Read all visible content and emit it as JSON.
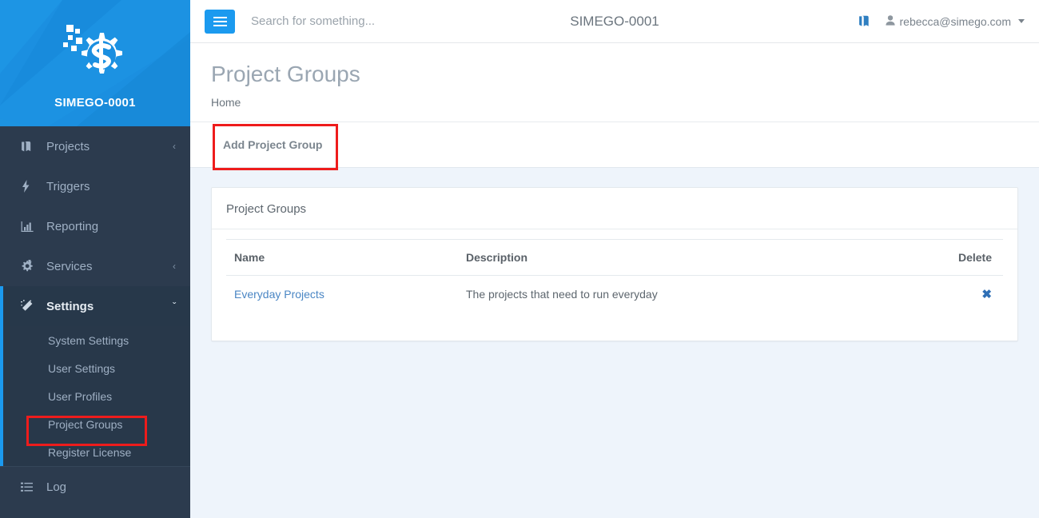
{
  "brand": {
    "title": "SIMEGO-0001",
    "logo_icon": "gear-s-logo"
  },
  "sidebar": {
    "items": [
      {
        "label": "Projects",
        "icon": "book-icon",
        "chevron": "‹",
        "active": false
      },
      {
        "label": "Triggers",
        "icon": "bolt-icon",
        "chevron": "",
        "active": false
      },
      {
        "label": "Reporting",
        "icon": "bar-chart-icon",
        "chevron": "",
        "active": false
      },
      {
        "label": "Services",
        "icon": "gears-icon",
        "chevron": "‹",
        "active": false
      },
      {
        "label": "Settings",
        "icon": "magic-wand-icon",
        "chevron": "ˇ",
        "active": true
      }
    ],
    "submenu": [
      {
        "label": "System Settings",
        "highlighted": false
      },
      {
        "label": "User Settings",
        "highlighted": false
      },
      {
        "label": "User Profiles",
        "highlighted": false
      },
      {
        "label": "Project Groups",
        "highlighted": true
      },
      {
        "label": "Register License",
        "highlighted": false
      }
    ],
    "bottom": {
      "label": "Log",
      "icon": "list-icon"
    }
  },
  "topbar": {
    "menu_button_icon": "hamburger-icon",
    "search_placeholder": "Search for something...",
    "search_value": "",
    "title": "SIMEGO-0001",
    "book_icon": "book-icon",
    "user_icon": "user-icon",
    "user_email": "rebecca@simego.com"
  },
  "page": {
    "title": "Project Groups",
    "breadcrumb": "Home"
  },
  "toolbar": {
    "add_label": "Add Project Group"
  },
  "panel": {
    "heading": "Project Groups",
    "columns": {
      "name": "Name",
      "description": "Description",
      "delete": "Delete"
    },
    "rows": [
      {
        "name": "Everyday Projects",
        "description": "The projects that need to run everyday",
        "delete_icon": "✖"
      }
    ]
  },
  "colors": {
    "brand_blue": "#1b8fe0",
    "accent_blue": "#1b9aef",
    "sidebar_bg": "#2c3b4e",
    "submenu_bg": "#28384a",
    "content_bg": "#eef4fb",
    "link_blue": "#4a86c4",
    "annotation_red": "#ee1c1c"
  }
}
